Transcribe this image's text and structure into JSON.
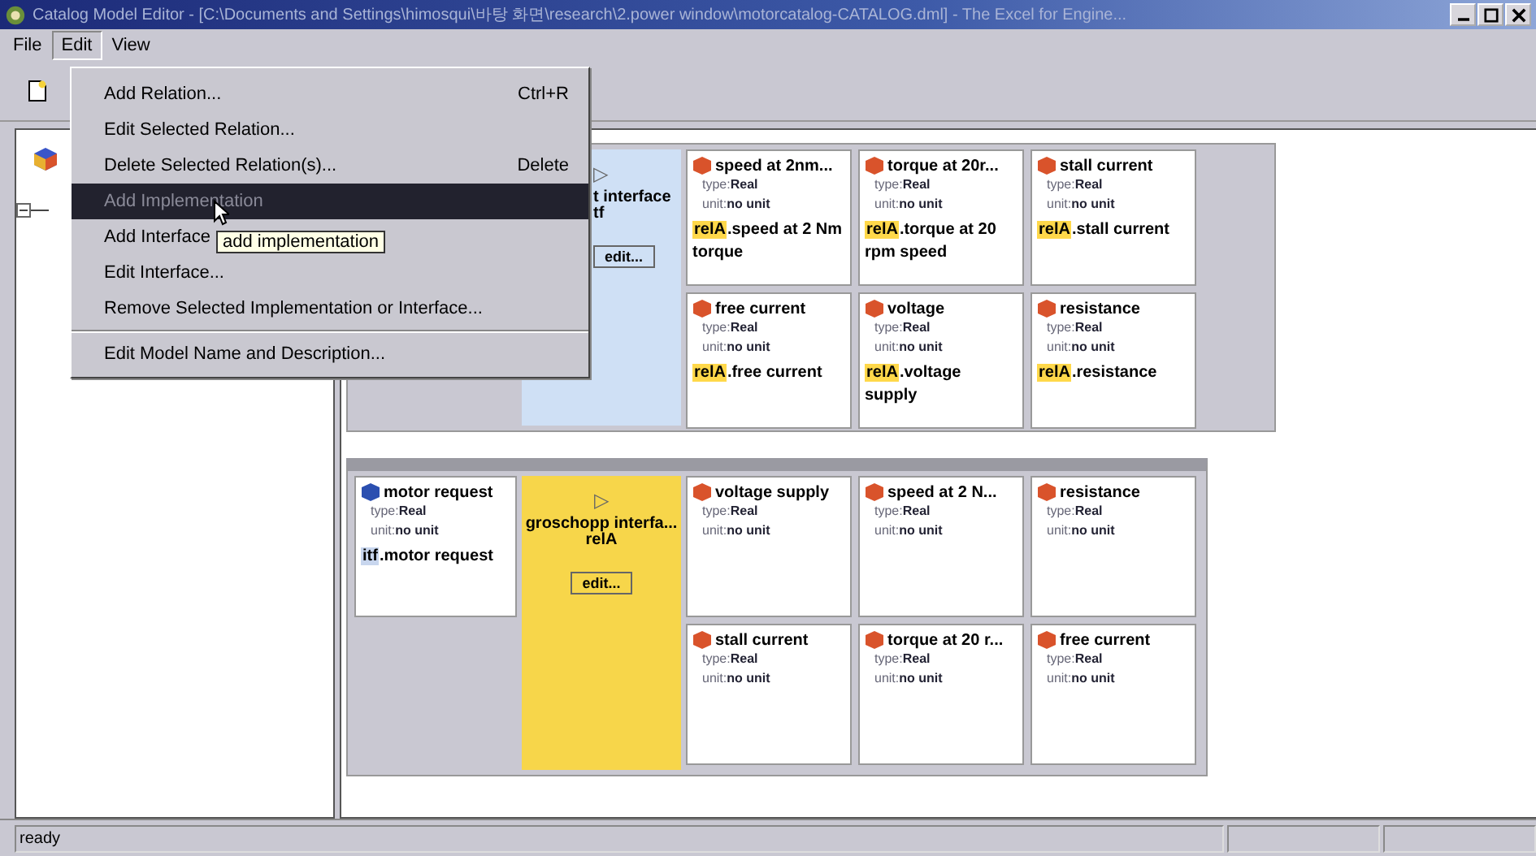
{
  "window": {
    "title": "Catalog Model Editor - [C:\\Documents and Settings\\himosqui\\바탕 화면\\research\\2.power window\\motorcatalog-CATALOG.dml] - The Excel for Engine..."
  },
  "menu_bar": [
    {
      "label": "File",
      "selected": false
    },
    {
      "label": "Edit",
      "selected": true
    },
    {
      "label": "View",
      "selected": false
    }
  ],
  "edit_menu": [
    {
      "label": "Add Relation...",
      "shortcut": "Ctrl+R",
      "disabled": false,
      "selected": false
    },
    {
      "label": "Edit Selected Relation...",
      "disabled": false,
      "selected": false
    },
    {
      "label": "Delete Selected Relation(s)...",
      "shortcut": "Delete",
      "disabled": false,
      "selected": false
    },
    {
      "label": "Add Implementation",
      "disabled": true,
      "selected": true
    },
    {
      "label": "Add Interface",
      "disabled": false,
      "selected": false
    },
    {
      "label": "Edit Interface...",
      "disabled": false,
      "selected": false
    },
    {
      "label": "Remove Selected Implementation or Interface...",
      "disabled": false,
      "selected": false
    },
    {
      "label": "Edit Model Name and Description...",
      "disabled": false,
      "selected": false,
      "separator_before": true
    }
  ],
  "tooltip": "add implementation",
  "relations": [
    {
      "interface": {
        "arrow": "▷",
        "name": "t interface",
        "sub": "tf",
        "button": "edit...",
        "color": "#cfe0f5"
      },
      "cards": [
        {
          "name": "speed at 2nm...",
          "type_label": "type:",
          "type": "Real",
          "unit_label": "unit:",
          "unit": "no unit",
          "color": "#d9532b",
          "mapping": {
            "prefix": "relA",
            "text": ".speed at 2 Nm torque",
            "color": "#ffd84a"
          }
        },
        {
          "name": "torque at 20r...",
          "type_label": "type:",
          "type": "Real",
          "unit_label": "unit:",
          "unit": "no unit",
          "color": "#d9532b",
          "mapping": {
            "prefix": "relA",
            "text": ".torque at 20 rpm speed",
            "color": "#ffd84a"
          }
        },
        {
          "name": "stall current",
          "type_label": "type:",
          "type": "Real",
          "unit_label": "unit:",
          "unit": "no unit",
          "color": "#d9532b",
          "mapping": {
            "prefix": "relA",
            "text": ".stall current",
            "color": "#ffd84a"
          }
        },
        {
          "name": "free current",
          "type_label": "type:",
          "type": "Real",
          "unit_label": "unit:",
          "unit": "no unit",
          "color": "#d9532b",
          "mapping": {
            "prefix": "relA",
            "text": ".free current",
            "color": "#ffd84a"
          }
        },
        {
          "name": "voltage",
          "type_label": "type:",
          "type": "Real",
          "unit_label": "unit:",
          "unit": "no unit",
          "color": "#d9532b",
          "mapping": {
            "prefix": "relA",
            "text": ".voltage supply",
            "color": "#ffd84a"
          }
        },
        {
          "name": "resistance",
          "type_label": "type:",
          "type": "Real",
          "unit_label": "unit:",
          "unit": "no unit",
          "color": "#d9532b",
          "mapping": {
            "prefix": "relA",
            "text": ".resistance",
            "color": "#ffd84a"
          }
        }
      ]
    },
    {
      "input_card": {
        "name": "motor request",
        "type_label": "type:",
        "type": "Real",
        "unit_label": "unit:",
        "unit": "no unit",
        "color": "#2b4fb0",
        "mapping": {
          "prefix": "itf",
          "text": ".motor request",
          "color": "#c8d6ee"
        }
      },
      "interface": {
        "arrow": "▷",
        "name": "groschopp interfa...",
        "sub": "relA",
        "button": "edit...",
        "color": "#f7d64a"
      },
      "cards": [
        {
          "name": "voltage supply",
          "type_label": "type:",
          "type": "Real",
          "unit_label": "unit:",
          "unit": "no unit",
          "color": "#d9532b"
        },
        {
          "name": "speed at 2 N...",
          "type_label": "type:",
          "type": "Real",
          "unit_label": "unit:",
          "unit": "no unit",
          "color": "#d9532b"
        },
        {
          "name": "resistance",
          "type_label": "type:",
          "type": "Real",
          "unit_label": "unit:",
          "unit": "no unit",
          "color": "#d9532b"
        },
        {
          "name": "stall current",
          "type_label": "type:",
          "type": "Real",
          "unit_label": "unit:",
          "unit": "no unit",
          "color": "#d9532b"
        },
        {
          "name": "torque at 20 r...",
          "type_label": "type:",
          "type": "Real",
          "unit_label": "unit:",
          "unit": "no unit",
          "color": "#d9532b"
        },
        {
          "name": "free current",
          "type_label": "type:",
          "type": "Real",
          "unit_label": "unit:",
          "unit": "no unit",
          "color": "#d9532b"
        }
      ]
    }
  ],
  "status_bar": {
    "text": "ready"
  }
}
